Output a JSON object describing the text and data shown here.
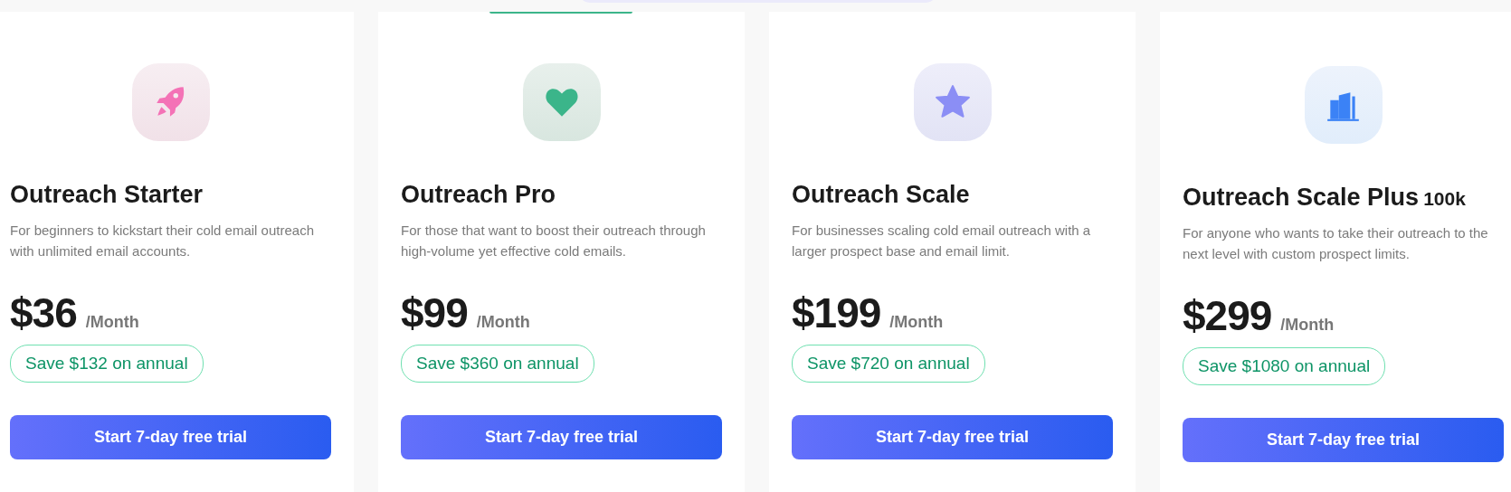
{
  "plans": [
    {
      "title": "Outreach Starter",
      "description": "For beginners to kickstart their cold email outreach with unlimited email accounts.",
      "price": "$36",
      "period": "/Month",
      "savings": "Save $132 on annual",
      "button": "Start 7-day free trial"
    },
    {
      "title": "Outreach Pro",
      "description": "For those that want to boost their outreach through high-volume yet effective cold emails.",
      "price": "$99",
      "period": "/Month",
      "savings": "Save $360 on annual",
      "button": "Start 7-day free trial"
    },
    {
      "title": "Outreach Scale",
      "description": "For businesses scaling cold email outreach with a larger prospect base and email limit.",
      "price": "$199",
      "period": "/Month",
      "savings": "Save $720 on annual",
      "button": "Start 7-day free trial"
    },
    {
      "title": "Outreach Scale Plus",
      "title_suffix": "100k",
      "description": "For anyone who wants to take their outreach to the next level with custom prospect limits.",
      "price": "$299",
      "period": "/Month",
      "savings": "Save $1080 on annual",
      "button": "Start 7-day free trial"
    }
  ]
}
